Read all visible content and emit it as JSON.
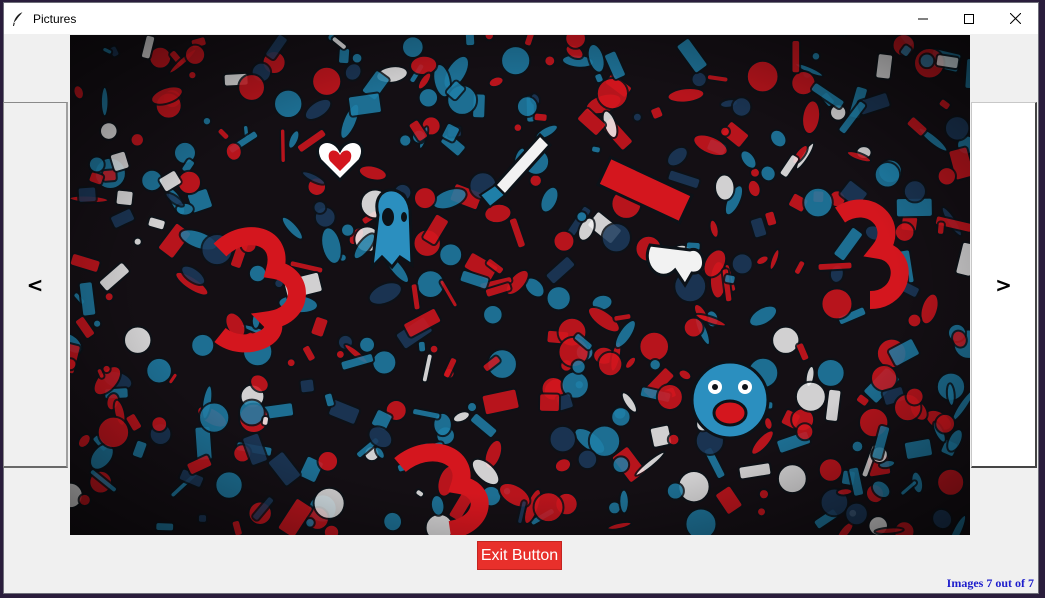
{
  "window": {
    "title": "Pictures",
    "icon": "feather-icon",
    "controls": [
      "minimize-icon",
      "maximize-icon",
      "close-icon"
    ]
  },
  "viewer": {
    "prev_label": "<",
    "next_label": ">",
    "image": {
      "description_icon": "doodle-art-image",
      "palette": {
        "background": "#140f14",
        "red": "#d4161e",
        "blue": "#1f7fa8",
        "white": "#f2f2f2",
        "navy": "#1c3a5c"
      }
    }
  },
  "exit_button": {
    "label": "Exit Button",
    "color": "#e8302b"
  },
  "status": {
    "text": "Images 7 out of 7",
    "color": "#1d1dcc"
  }
}
